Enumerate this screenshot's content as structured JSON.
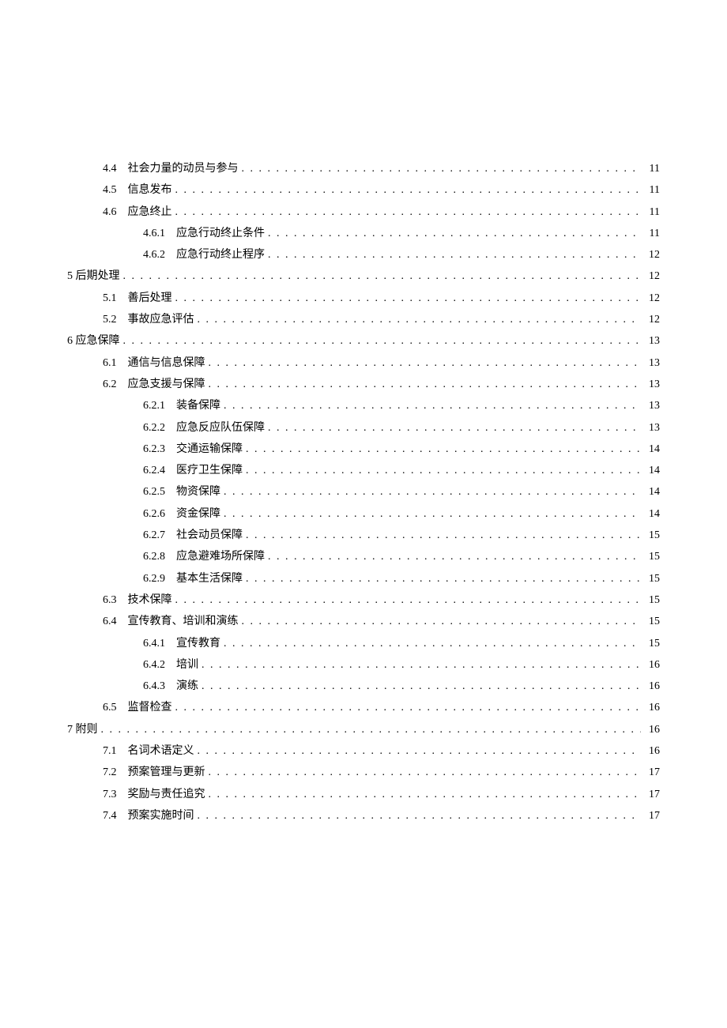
{
  "toc": [
    {
      "level": 2,
      "num": "4.4",
      "title": "社会力量的动员与参与",
      "page": "11"
    },
    {
      "level": 2,
      "num": "4.5",
      "title": "信息发布",
      "page": "11"
    },
    {
      "level": 2,
      "num": "4.6",
      "title": "应急终止",
      "page": "11"
    },
    {
      "level": 3,
      "num": "4.6.1",
      "title": "应急行动终止条件",
      "page": "11"
    },
    {
      "level": 3,
      "num": "4.6.2",
      "title": "应急行动终止程序",
      "page": "12"
    },
    {
      "level": 1,
      "num": "5",
      "title": "后期处理",
      "page": "12"
    },
    {
      "level": 2,
      "num": "5.1",
      "title": "善后处理",
      "page": "12"
    },
    {
      "level": 2,
      "num": "5.2",
      "title": "事故应急评估",
      "page": "12"
    },
    {
      "level": 1,
      "num": "6",
      "title": "应急保障",
      "page": "13"
    },
    {
      "level": 2,
      "num": "6.1",
      "title": "通信与信息保障",
      "page": "13"
    },
    {
      "level": 2,
      "num": "6.2",
      "title": "应急支援与保障",
      "page": "13"
    },
    {
      "level": 3,
      "num": "6.2.1",
      "title": "装备保障",
      "page": "13"
    },
    {
      "level": 3,
      "num": "6.2.2",
      "title": "应急反应队伍保障",
      "page": "13"
    },
    {
      "level": 3,
      "num": "6.2.3",
      "title": "交通运输保障",
      "page": "14"
    },
    {
      "level": 3,
      "num": "6.2.4",
      "title": "医疗卫生保障",
      "page": "14"
    },
    {
      "level": 3,
      "num": "6.2.5",
      "title": "物资保障",
      "page": "14"
    },
    {
      "level": 3,
      "num": "6.2.6",
      "title": "资金保障",
      "page": "14"
    },
    {
      "level": 3,
      "num": "6.2.7",
      "title": "社会动员保障",
      "page": "15"
    },
    {
      "level": 3,
      "num": "6.2.8",
      "title": "应急避难场所保障",
      "page": "15"
    },
    {
      "level": 3,
      "num": "6.2.9",
      "title": "基本生活保障",
      "page": "15"
    },
    {
      "level": 2,
      "num": "6.3",
      "title": "技术保障",
      "page": "15"
    },
    {
      "level": 2,
      "num": "6.4",
      "title": "宣传教育、培训和演练",
      "page": "15"
    },
    {
      "level": 3,
      "num": "6.4.1",
      "title": "宣传教育",
      "page": "15"
    },
    {
      "level": 3,
      "num": "6.4.2",
      "title": "培训",
      "page": "16"
    },
    {
      "level": 3,
      "num": "6.4.3",
      "title": "演练",
      "page": "16"
    },
    {
      "level": 2,
      "num": "6.5",
      "title": "监督检查",
      "page": "16"
    },
    {
      "level": 1,
      "num": "7",
      "title": "附则",
      "page": "16"
    },
    {
      "level": 2,
      "num": "7.1",
      "title": "名词术语定义",
      "page": "16"
    },
    {
      "level": 2,
      "num": "7.2",
      "title": "预案管理与更新",
      "page": "17"
    },
    {
      "level": 2,
      "num": "7.3",
      "title": "奖励与责任追究",
      "page": "17"
    },
    {
      "level": 2,
      "num": "7.4",
      "title": "预案实施时间",
      "page": "17"
    }
  ]
}
